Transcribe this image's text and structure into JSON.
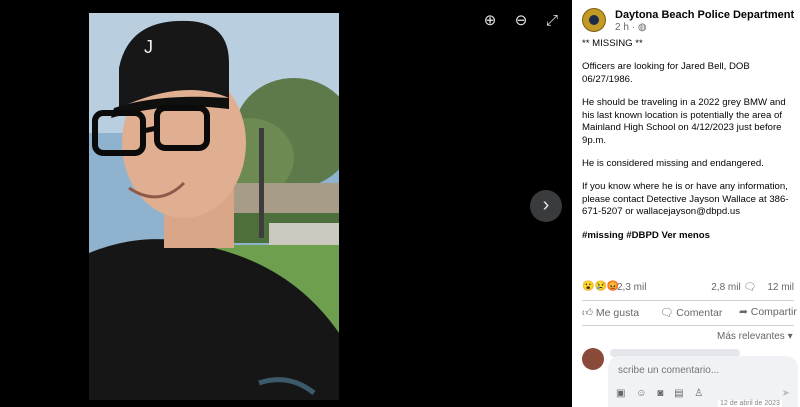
{
  "viewer": {
    "zoom_in_icon": "zoom-in-icon",
    "zoom_out_icon": "zoom-out-icon",
    "fullscreen_icon": "expand-icon",
    "next_icon": "chevron-right-icon"
  },
  "post": {
    "page_name": "Daytona Beach Police Department",
    "time": "2 h",
    "privacy_icon": "globe-icon",
    "paragraphs": [
      "** MISSING **",
      "Officers are looking for Jared Bell, DOB 06/27/1986.",
      "He should be traveling in a 2022 grey BMW and his last known location is potentially the area of Mainland High School on 4/12/2023 just before 9p.m.",
      "He is considered missing and endangered.",
      "If you know where he is or have any information, please contact Detective Jayson Wallace at 386-671-5207 or wallacejayson@dbpd.us"
    ],
    "hashtags": "#missing #DBPD",
    "see_less": "Ver menos"
  },
  "reactions": {
    "count": "2,3 mil",
    "comments": "2,8 mil",
    "shares": "12 mil"
  },
  "actions": {
    "like": "Me gusta",
    "comment": "Comentar",
    "share": "Compartir"
  },
  "comments": {
    "sort": "Más relevantes",
    "placeholder": "scribe un comentario...",
    "partial_date": "12 de abril de 2023"
  },
  "colors": {
    "accent": "#1877f2",
    "background": "#000000",
    "panel": "#ffffff"
  }
}
